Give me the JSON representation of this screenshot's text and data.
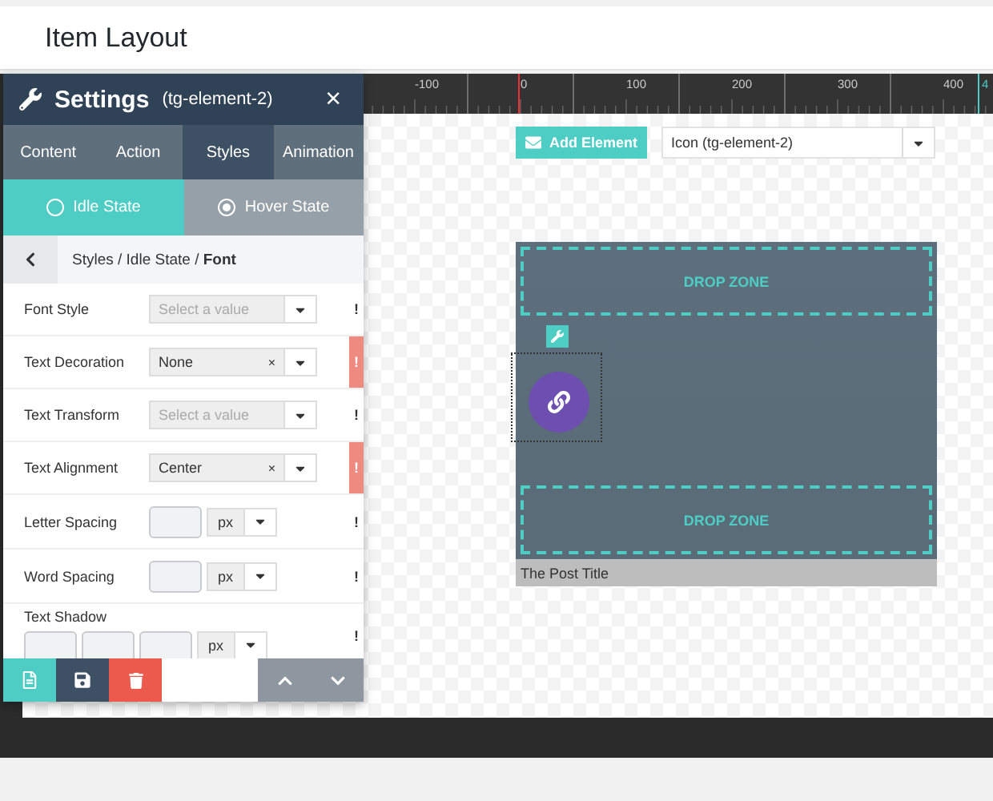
{
  "page_title": "Item Layout",
  "settings": {
    "title": "Settings",
    "element": "(tg-element-2)",
    "close": "×",
    "tabs": [
      {
        "label": "Content",
        "selected": false
      },
      {
        "label": "Action",
        "selected": false
      },
      {
        "label": "Styles",
        "selected": true
      },
      {
        "label": "Animation",
        "selected": false
      }
    ],
    "states": [
      {
        "label": "Idle State",
        "selected": true,
        "checked": false
      },
      {
        "label": "Hover State",
        "selected": false,
        "checked": true
      }
    ],
    "breadcrumb": "Styles / Idle State / **Font**",
    "fields": [
      {
        "kind": "select",
        "label": "Font Style",
        "placeholder": "Select a value",
        "important": false
      },
      {
        "kind": "select",
        "label": "Text Decoration",
        "value": "None",
        "clear": "×",
        "important": true
      },
      {
        "kind": "select",
        "label": "Text Transform",
        "placeholder": "Select a value",
        "important": false
      },
      {
        "kind": "select",
        "label": "Text Alignment",
        "value": "Center",
        "clear": "×",
        "important": true
      },
      {
        "kind": "number",
        "label": "Letter Spacing",
        "unit": "px",
        "important": false
      },
      {
        "kind": "number",
        "label": "Word Spacing",
        "unit": "px",
        "important": false
      },
      {
        "kind": "shadow",
        "label": "Text Shadow",
        "unit": "px",
        "important": false
      }
    ],
    "important_mark": "!"
  },
  "ruler": {
    "labels": [
      "-100",
      "0",
      "100",
      "200",
      "300",
      "400"
    ],
    "marker": "4"
  },
  "toolbar": {
    "add_button": "Add Element",
    "element_select": "Icon (tg-element-2)"
  },
  "card": {
    "drop_zones": [
      "DROP ZONE",
      "DROP ZONE"
    ],
    "post_title": "The Post Title"
  }
}
